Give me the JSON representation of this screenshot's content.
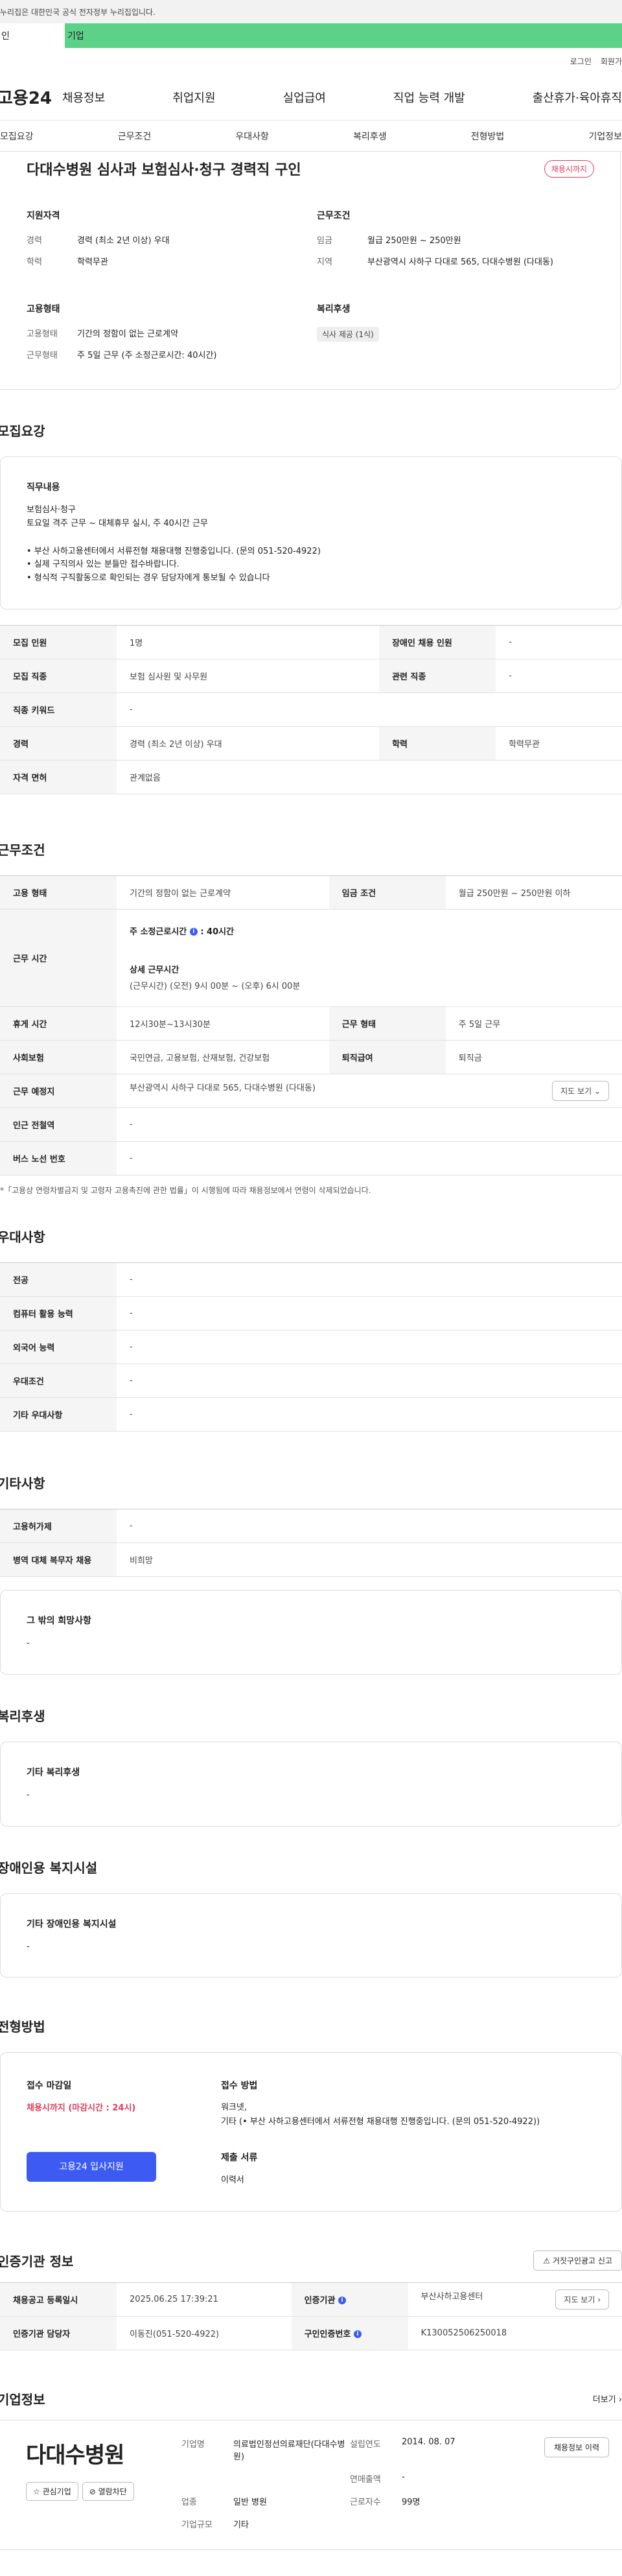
{
  "gov_notice": "누리집은 대한민국 공식 전자정부 누리집입니다.",
  "tabs": [
    "인",
    "기업"
  ],
  "util": [
    "로그인",
    "회원가"
  ],
  "gnb": {
    "logo": "고용24",
    "menu": [
      "채용정보",
      "취업지원",
      "실업급여",
      "직업 능력 개발",
      "출산휴가·육아휴직"
    ]
  },
  "anchors": [
    "모집요강",
    "근무조건",
    "우대사항",
    "복리후생",
    "전형방법",
    "기업정보"
  ],
  "header": {
    "title": "다대수병원 심사과 보험심사·청구 경력직 구인",
    "badge": "채용시까지",
    "qual_title": "지원자격",
    "qual": [
      {
        "k": "경력",
        "v": "경력 (최소 2년 이상) 우대"
      },
      {
        "k": "학력",
        "v": "학력무관"
      }
    ],
    "cond_title": "근무조건",
    "cond": [
      {
        "k": "임금",
        "v": "월급 250만원 ~ 250만원"
      },
      {
        "k": "지역",
        "v": "부산광역시 사하구 다대로 565, 다대수병원 (다대동)"
      }
    ],
    "emp_title": "고용형태",
    "emp": [
      {
        "k": "고용형태",
        "v": "기간의 정함이 없는 근로계약"
      },
      {
        "k": "근무형태",
        "v": "주 5일 근무 (주 소정근로시간: 40시간)"
      }
    ],
    "welfare_title": "복리후생",
    "welfare_tag": "식사 제공 (1식)"
  },
  "recruit": {
    "title": "모집요강",
    "duty_title": "직무내용",
    "duty_lines": [
      "보험심사·청구",
      "토요일 격주 근무 ~ 대체휴무 실시, 주 40시간 근무"
    ],
    "bullets": [
      "• 부산 사하고용센터에서 서류전형 채용대행 진행중입니다. (문의 051-520-4922)",
      "• 실제 구직의사 있는 분들만 접수바랍니다.",
      "• 형식적 구직활동으로 확인되는 경우 담당자에게 통보될 수 있습니다"
    ],
    "rows": [
      [
        "모집 인원",
        "1명",
        "장애인 채용 인원",
        "-"
      ],
      [
        "모집 직종",
        "보험 심사원 및 사무원",
        "관련 직종",
        "-"
      ],
      [
        "직종 키워드",
        "-"
      ],
      [
        "경력",
        "경력 (최소 2년 이상) 우대",
        "학력",
        "학력무관"
      ],
      [
        "자격 면허",
        "관계없음"
      ]
    ]
  },
  "work": {
    "title": "근무조건",
    "employ_type_k": "고용 형태",
    "employ_type_v": "기간의 정함이 없는 근로계약",
    "wage_k": "임금 조건",
    "wage_v": "월급 250만원 ~ 250만원 이하",
    "hours_k": "근무 시간",
    "hours_weekly": "주 소정근로시간",
    "hours_weekly_val": ": 40시간",
    "hours_detail_title": "상세 근무시간",
    "hours_detail": "(근무시간) (오전) 9시 00분 ~ (오후) 6시 00분",
    "rest_k": "휴게 시간",
    "rest_v": "12시30분~13시30분",
    "form_k": "근무 형태",
    "form_v": "주 5일 근무",
    "insure_k": "사회보험",
    "insure_v": "국민연금, 고용보험, 산재보험, 건강보험",
    "retire_k": "퇴직급여",
    "retire_v": "퇴직금",
    "place_k": "근무 예정지",
    "place_v": "부산광역시 사하구 다대로 565, 다대수병원 (다대동)",
    "map_btn": "지도 보기 ⌄",
    "subway_k": "인근 전철역",
    "subway_v": "-",
    "bus_k": "버스 노선 번호",
    "bus_v": "-",
    "note": "*「고용상 연령차별금지 및 고령자 고용촉진에 관한 법률」이 시행됨에 따라 채용정보에서 연령이 삭제되었습니다."
  },
  "prefer": {
    "title": "우대사항",
    "rows": [
      [
        "전공",
        "-"
      ],
      [
        "컴퓨터 활용 능력",
        "-"
      ],
      [
        "외국어 능력",
        "-"
      ],
      [
        "우대조건",
        "-"
      ],
      [
        "기타 우대사항",
        "-"
      ]
    ]
  },
  "etc": {
    "title": "기타사항",
    "rows": [
      [
        "고용허가제",
        "-"
      ],
      [
        "병역 대체 복무자 채용",
        "비희망"
      ]
    ],
    "hope_title": "그 밖의 희망사항",
    "hope_val": "-"
  },
  "welfare": {
    "title": "복리후생",
    "box_title": "기타 복리후생",
    "box_val": "-"
  },
  "disabled": {
    "title": "장애인용 복지시설",
    "box_title": "기타 장애인용 복지시설",
    "box_val": "-"
  },
  "process": {
    "title": "전형방법",
    "deadline_title": "접수 마감일",
    "deadline_val": "채용시까지 (마감시간 : 24시)",
    "apply_btn": "고용24 입사지원",
    "method_title": "접수 방법",
    "method_lines": [
      "워크넷,",
      "기타 (• 부산 사하고용센터에서 서류전형 채용대행 진행중입니다. (문의 051-520-4922))"
    ],
    "docs_title": "제출 서류",
    "docs_val": "이력서"
  },
  "cert": {
    "title": "인증기관 정보",
    "report_btn": "⚠ 거짓구인광고 신고",
    "rows": [
      [
        "채용공고 등록일시",
        "2025.06.25 17:39:21",
        "인증기관",
        "부산사하고용센터"
      ],
      [
        "인증기관 담당자",
        "이동진(051-520-4922)",
        "구인인증번호",
        "K130052506250018"
      ]
    ],
    "map_btn": "지도 보기 ›"
  },
  "corp": {
    "title": "기업정보",
    "more": "더보기 ›",
    "logo_text": "다대수병원",
    "btn_fav": "☆ 관심기업",
    "btn_block": "⊘ 열람차단",
    "fields": [
      [
        "기업명",
        "의료법인정선의료재단(다대수병원)",
        "설립연도",
        "2014. 08. 07"
      ],
      [
        "",
        "",
        "연매출액",
        "-"
      ],
      [
        "업종",
        "일반 병원",
        "근로자수",
        "99명"
      ],
      [
        "기업규모",
        "기타",
        "",
        ""
      ]
    ],
    "history_btn": "채용정보 이력"
  }
}
